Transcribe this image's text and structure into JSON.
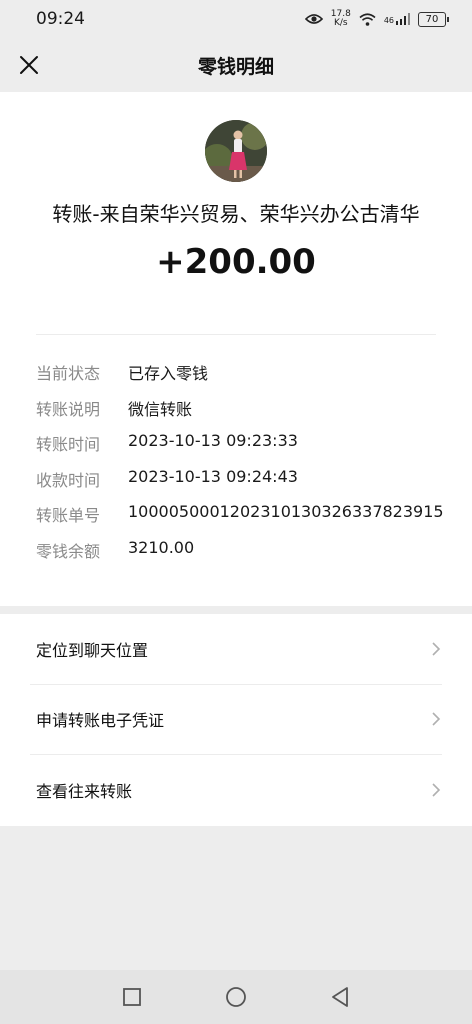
{
  "status_bar": {
    "time": "09:24",
    "speed_value": "17.8",
    "speed_unit": "K/s",
    "network": "46",
    "battery": "70"
  },
  "header": {
    "title": "零钱明细"
  },
  "transfer": {
    "source": "转账-来自荣华兴贸易、荣华兴办公古清华",
    "amount": "+200.00"
  },
  "details": [
    {
      "label": "当前状态",
      "value": "已存入零钱"
    },
    {
      "label": "转账说明",
      "value": "微信转账"
    },
    {
      "label": "转账时间",
      "value": "2023-10-13 09:23:33"
    },
    {
      "label": "收款时间",
      "value": "2023-10-13 09:24:43"
    },
    {
      "label": "转账单号",
      "value": "1000050001202310130326337823915"
    },
    {
      "label": "零钱余额",
      "value": "3210.00"
    }
  ],
  "actions": [
    {
      "label": "定位到聊天位置"
    },
    {
      "label": "申请转账电子凭证"
    },
    {
      "label": "查看往来转账"
    }
  ],
  "icons": {
    "close": "close-icon",
    "chevron": "chevron-right-icon",
    "eye": "eye-icon",
    "wifi": "wifi-icon",
    "signal": "signal-icon",
    "battery": "battery-icon",
    "recents": "square-icon",
    "home": "circle-icon",
    "back": "triangle-back-icon"
  }
}
